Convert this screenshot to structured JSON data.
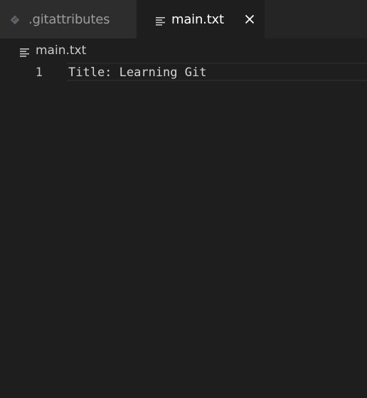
{
  "tabs": [
    {
      "label": ".gitattributes",
      "icon": "git-icon",
      "active": false
    },
    {
      "label": "main.txt",
      "icon": "text-lines-icon",
      "active": true,
      "close_icon": "close-icon"
    }
  ],
  "breadcrumb": {
    "icon": "text-lines-icon",
    "label": "main.txt"
  },
  "editor": {
    "lines": [
      {
        "number": "1",
        "text": "Title: Learning Git"
      }
    ]
  },
  "colors": {
    "background": "#1e1e1e",
    "tabbar": "#252526",
    "inactive_tab": "#2d2d2d",
    "inactive_text": "#9d9d9d",
    "active_text": "#ffffff",
    "code_text": "#d4d4d4"
  }
}
